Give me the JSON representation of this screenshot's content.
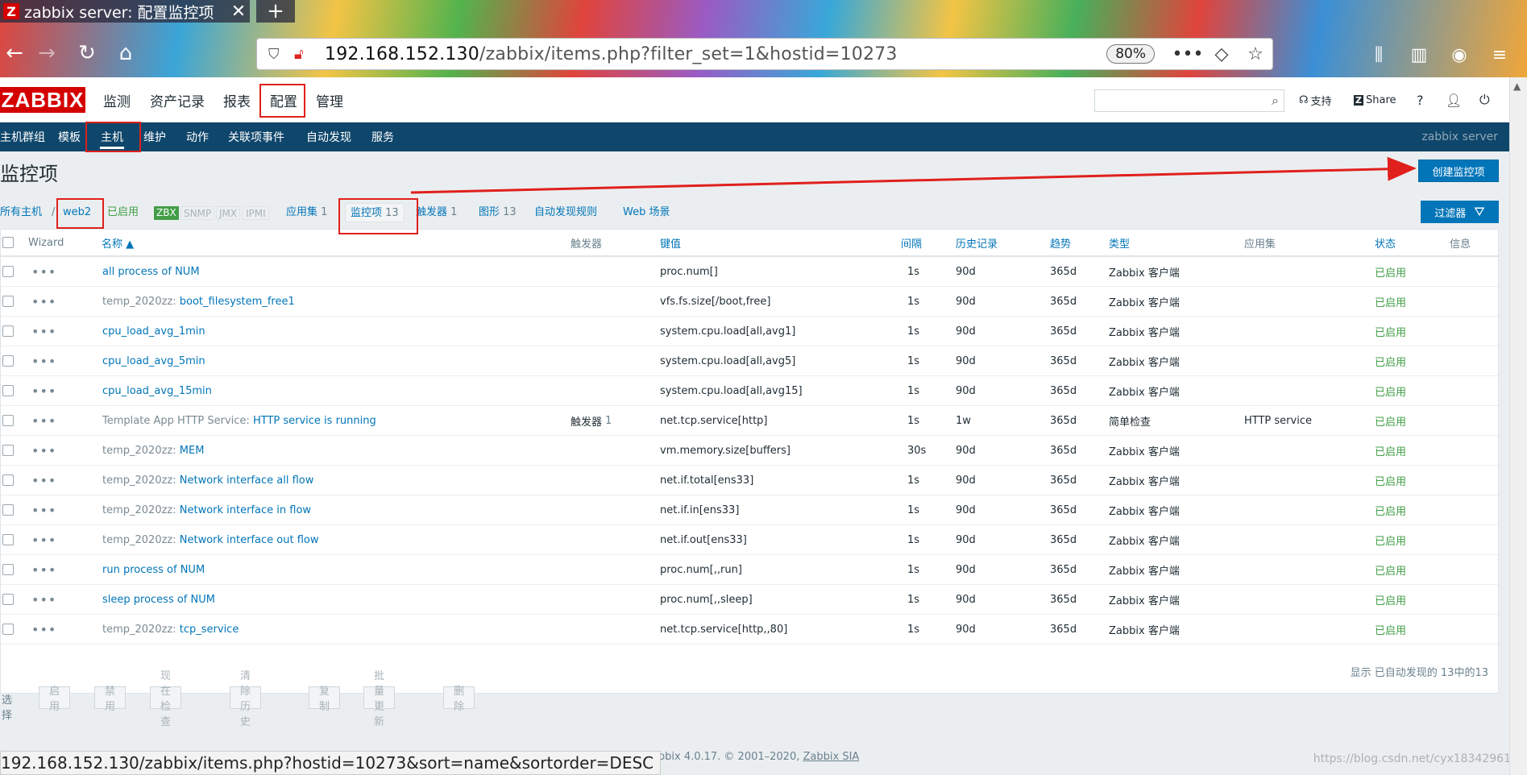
{
  "browser": {
    "tab_title": "zabbix server: 配置监控项",
    "tab_logo": "Z",
    "url_host": "192.168.152.130",
    "url_path": "/zabbix/items.php?filter_set=1&hostid=10273",
    "zoom": "80%",
    "status_url": "192.168.152.130/zabbix/items.php?hostid=10273&sort=name&sortorder=DESC"
  },
  "header": {
    "logo": "ZABBIX",
    "menu": [
      "监测",
      "资产记录",
      "报表",
      "配置",
      "管理"
    ],
    "support": "支持",
    "share": "Share",
    "help": "?"
  },
  "submenu": {
    "items": [
      "主机群组",
      "模板",
      "主机",
      "维护",
      "动作",
      "关联项事件",
      "自动发现",
      "服务"
    ],
    "server_name": "zabbix server"
  },
  "page": {
    "title": "监控项",
    "create_button": "创建监控项",
    "filter_button": "过滤器"
  },
  "breadcrumb": {
    "all_hosts": "所有主机",
    "sep": "/",
    "host": "web2",
    "status": "已启用",
    "zbx": "ZBX",
    "snmp": "SNMP",
    "jmx": "JMX",
    "ipmi": "IPMI",
    "applications": "应用集",
    "applications_count": "1",
    "items": "监控项",
    "items_count": "13",
    "triggers": "触发器",
    "triggers_count": "1",
    "graphs": "图形",
    "graphs_count": "13",
    "discovery": "自动发现规则",
    "web": "Web 场景"
  },
  "table": {
    "headers": {
      "wizard": "Wizard",
      "name": "名称 ▲",
      "triggers": "触发器",
      "key": "键值",
      "interval": "间隔",
      "history": "历史记录",
      "trends": "趋势",
      "type": "类型",
      "applications": "应用集",
      "status": "状态",
      "info": "信息"
    },
    "rows": [
      {
        "prefix": "",
        "name": "all process of NUM",
        "triggers": "",
        "triggers_count": "",
        "key": "proc.num[]",
        "interval": "1s",
        "history": "90d",
        "trends": "365d",
        "type": "Zabbix 客户端",
        "app": "",
        "status": "已启用"
      },
      {
        "prefix": "temp_2020zz: ",
        "name": "boot_filesystem_free1",
        "triggers": "",
        "triggers_count": "",
        "key": "vfs.fs.size[/boot,free]",
        "interval": "1s",
        "history": "90d",
        "trends": "365d",
        "type": "Zabbix 客户端",
        "app": "",
        "status": "已启用"
      },
      {
        "prefix": "",
        "name": "cpu_load_avg_1min",
        "triggers": "",
        "triggers_count": "",
        "key": "system.cpu.load[all,avg1]",
        "interval": "1s",
        "history": "90d",
        "trends": "365d",
        "type": "Zabbix 客户端",
        "app": "",
        "status": "已启用"
      },
      {
        "prefix": "",
        "name": "cpu_load_avg_5min",
        "triggers": "",
        "triggers_count": "",
        "key": "system.cpu.load[all,avg5]",
        "interval": "1s",
        "history": "90d",
        "trends": "365d",
        "type": "Zabbix 客户端",
        "app": "",
        "status": "已启用"
      },
      {
        "prefix": "",
        "name": "cpu_load_avg_15min",
        "triggers": "",
        "triggers_count": "",
        "key": "system.cpu.load[all,avg15]",
        "interval": "1s",
        "history": "90d",
        "trends": "365d",
        "type": "Zabbix 客户端",
        "app": "",
        "status": "已启用"
      },
      {
        "prefix": "Template App HTTP Service: ",
        "name": "HTTP service is running",
        "triggers": "触发器",
        "triggers_count": "1",
        "key": "net.tcp.service[http]",
        "interval": "1s",
        "history": "1w",
        "trends": "365d",
        "type": "简单检查",
        "app": "HTTP service",
        "status": "已启用"
      },
      {
        "prefix": "temp_2020zz: ",
        "name": "MEM",
        "triggers": "",
        "triggers_count": "",
        "key": "vm.memory.size[buffers]",
        "interval": "30s",
        "history": "90d",
        "trends": "365d",
        "type": "Zabbix 客户端",
        "app": "",
        "status": "已启用"
      },
      {
        "prefix": "temp_2020zz: ",
        "name": "Network interface all flow",
        "triggers": "",
        "triggers_count": "",
        "key": "net.if.total[ens33]",
        "interval": "1s",
        "history": "90d",
        "trends": "365d",
        "type": "Zabbix 客户端",
        "app": "",
        "status": "已启用"
      },
      {
        "prefix": "temp_2020zz: ",
        "name": "Network interface in flow",
        "triggers": "",
        "triggers_count": "",
        "key": "net.if.in[ens33]",
        "interval": "1s",
        "history": "90d",
        "trends": "365d",
        "type": "Zabbix 客户端",
        "app": "",
        "status": "已启用"
      },
      {
        "prefix": "temp_2020zz: ",
        "name": "Network interface out flow",
        "triggers": "",
        "triggers_count": "",
        "key": "net.if.out[ens33]",
        "interval": "1s",
        "history": "90d",
        "trends": "365d",
        "type": "Zabbix 客户端",
        "app": "",
        "status": "已启用"
      },
      {
        "prefix": "",
        "name": "run process of NUM",
        "triggers": "",
        "triggers_count": "",
        "key": "proc.num[,,run]",
        "interval": "1s",
        "history": "90d",
        "trends": "365d",
        "type": "Zabbix 客户端",
        "app": "",
        "status": "已启用"
      },
      {
        "prefix": "",
        "name": "sleep process of NUM",
        "triggers": "",
        "triggers_count": "",
        "key": "proc.num[,,sleep]",
        "interval": "1s",
        "history": "90d",
        "trends": "365d",
        "type": "Zabbix 客户端",
        "app": "",
        "status": "已启用"
      },
      {
        "prefix": "temp_2020zz: ",
        "name": "tcp_service",
        "triggers": "",
        "triggers_count": "",
        "key": "net.tcp.service[http,,80]",
        "interval": "1s",
        "history": "90d",
        "trends": "365d",
        "type": "Zabbix 客户端",
        "app": "",
        "status": "已启用"
      }
    ],
    "footer_text": "显示 已自动发现的 13中的13"
  },
  "actions": {
    "select_label": "选择",
    "buttons": [
      "启用",
      "禁用",
      "现在检查",
      "清除历史",
      "复制",
      "批量更新",
      "删除"
    ]
  },
  "footer": {
    "text": "Zabbix 4.0.17. © 2001–2020,",
    "link": "Zabbix SIA"
  },
  "watermark": "https://blog.csdn.net/cyx18342961",
  "colors": {
    "zabbix_red": "#d40000",
    "nav_blue": "#0f466b",
    "link_blue": "#0275b8",
    "enabled_green": "#429e47",
    "annotation_red": "#e0201c"
  }
}
